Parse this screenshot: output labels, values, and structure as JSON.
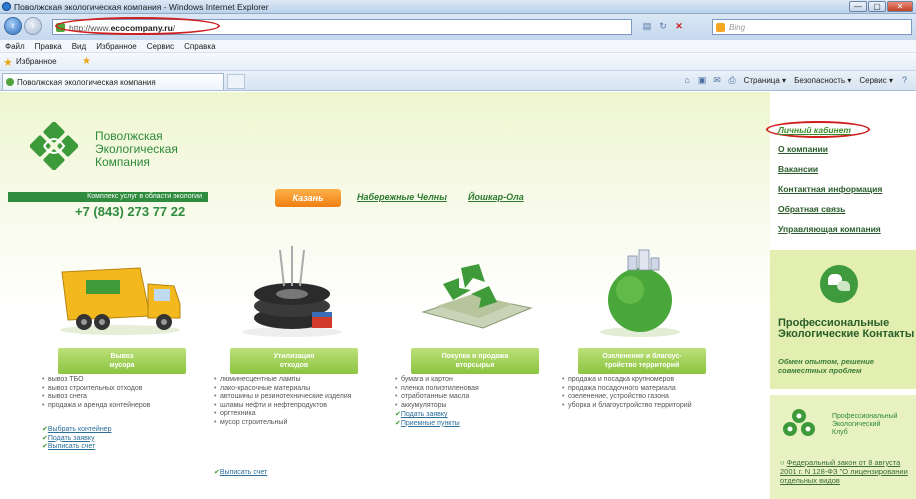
{
  "window": {
    "title": "Поволжская экологическая компания - Windows Internet Explorer",
    "min": "—",
    "max": "▢",
    "close": "✕"
  },
  "browser": {
    "url_prefix": "http://www.",
    "url_host": "ecocompany.ru",
    "url_suffix": "/",
    "search_placeholder": "Bing"
  },
  "menu": [
    "Файл",
    "Правка",
    "Вид",
    "Избранное",
    "Сервис",
    "Справка"
  ],
  "favorites": {
    "label": "Избранное"
  },
  "tab": {
    "label": "Поволжская экологическая компания"
  },
  "commandbar": {
    "page": "Страница ▾",
    "safety": "Безопасность ▾",
    "tools": "Сервис ▾"
  },
  "site": {
    "logo_lines": [
      "Поволжская",
      "Экологическая",
      "Компания"
    ],
    "tagline": "Комплекс услуг в области экологии",
    "phone": "+7 (843) 273 77 22",
    "cities": [
      "Казань",
      "Набережные Челны",
      "Йошкар-Ола"
    ]
  },
  "right_nav": {
    "personal": "Личный кабинет",
    "items": [
      "О компании",
      "Вакансии",
      "Контактная информация",
      "Обратная связь",
      "Управляющая компания"
    ]
  },
  "contacts_promo": {
    "title": "Профессиональные Экологические Контакты",
    "subtitle": "Обмен опытом, решение совместных проблем"
  },
  "club": {
    "lines": [
      "Профессиональный",
      "Экологический",
      "Клуб"
    ],
    "link": "Федеральный закон от 8 августа 2001 г. N 128-ФЗ \"О лицензировании отдельных видов"
  },
  "services": [
    {
      "header": [
        "Вывоз",
        "мусора"
      ],
      "items": [
        "вывоз ТБО",
        "вывоз строительных отходов",
        "вывоз снега",
        "продажа и аренда контейнеров"
      ],
      "actions": [
        "Выбрать контейнер",
        "Подать заявку",
        "Выписать счет"
      ]
    },
    {
      "header": [
        "Утилизация",
        "отходов"
      ],
      "items": [
        "люминесцентные лампы",
        "лако-красочные материалы",
        "автошины и резинотехнические изделия",
        "шламы нефти и нефтепродуктов",
        "оргтехника",
        "мусор строительный"
      ],
      "actions": [
        "Выписать счет"
      ]
    },
    {
      "header": [
        "Покупка и продажа",
        "вторсырья"
      ],
      "items": [
        "бумага и картон",
        "пленка полиэтиленовая",
        "отработанные масла",
        "аккумуляторы"
      ],
      "actions": [
        "Подать заявку",
        "Приемные пункты"
      ]
    },
    {
      "header": [
        "Озеленение и благоус-",
        "тройство территорий"
      ],
      "items": [
        "продажа и посадка крупномеров",
        "продажа посадочного материала",
        "озеленение, устройство газона",
        "уборка и благоустройство территорий"
      ],
      "actions": []
    }
  ]
}
